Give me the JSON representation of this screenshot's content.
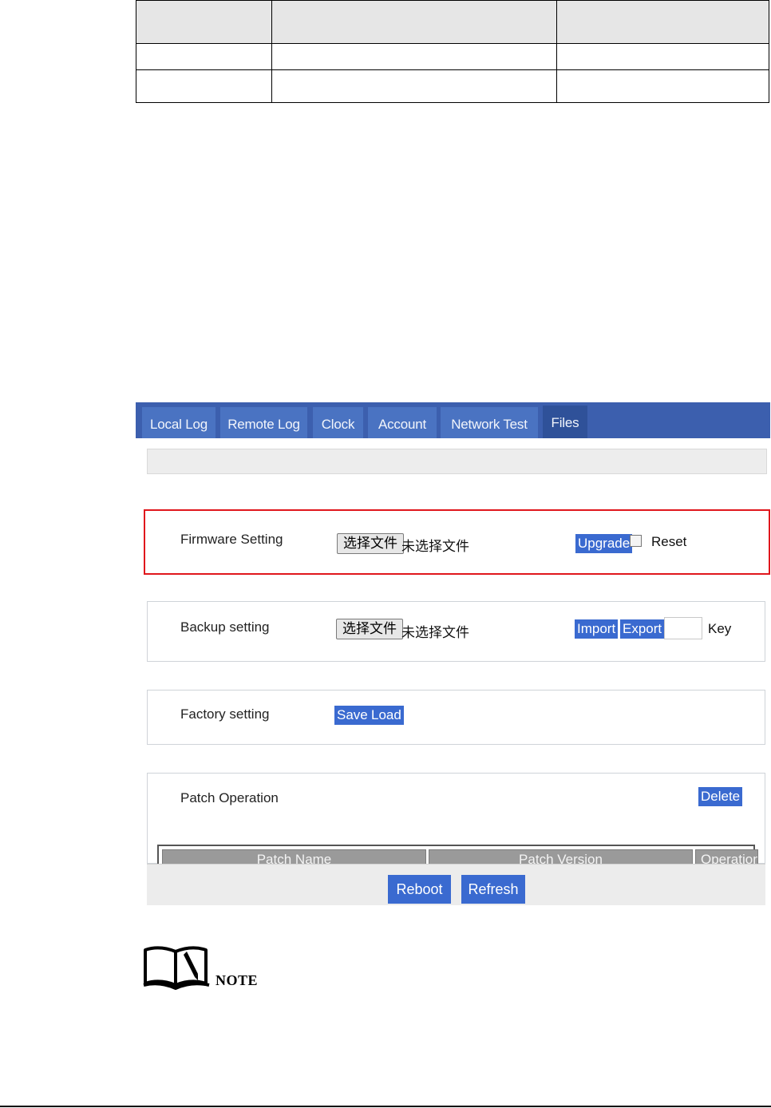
{
  "tabs": [
    {
      "label": "Local Log",
      "active": false
    },
    {
      "label": "Remote Log",
      "active": false
    },
    {
      "label": "Clock",
      "active": false
    },
    {
      "label": "Account",
      "active": false
    },
    {
      "label": "Network Test",
      "active": false
    },
    {
      "label": "Files",
      "active": true
    }
  ],
  "firmware": {
    "label": "Firmware Setting",
    "choose_file": "选择文件",
    "no_file": "未选择文件",
    "upgrade": "Upgrade",
    "reset_checked": false,
    "reset_label": "Reset"
  },
  "backup": {
    "label": "Backup setting",
    "choose_file": "选择文件",
    "no_file": "未选择文件",
    "import": "Import",
    "export": "Export",
    "key_value": "",
    "key_label": "Key"
  },
  "factory": {
    "label": "Factory setting",
    "save": "Save",
    "load": "Load"
  },
  "patch": {
    "label": "Patch Operation",
    "delete": "Delete",
    "columns": [
      "Patch Name",
      "Patch Version",
      "Operation"
    ]
  },
  "footer": {
    "reboot": "Reboot",
    "refresh": "Refresh"
  },
  "note": {
    "label": "NOTE",
    "icon": "book-pen-icon"
  },
  "colors": {
    "tabbar": "#3c5fae",
    "button": "#3a6ad0",
    "highlight": "#e0161c"
  }
}
